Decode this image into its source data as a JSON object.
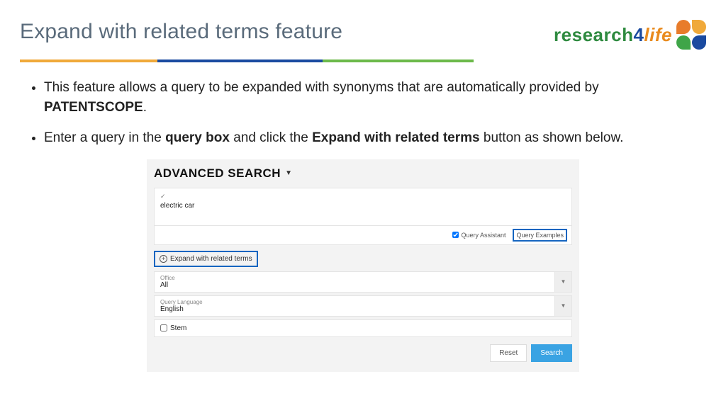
{
  "header": {
    "title": "Expand with related terms feature",
    "logo": {
      "word1": "research",
      "word2": "4",
      "word3": "life"
    }
  },
  "bullets": {
    "b1_pre": "This feature allows a query to be expanded with synonyms that are automatically provided by ",
    "b1_bold": "PATENTSCOPE",
    "b1_post": ".",
    "b2_pre": "Enter a query in the ",
    "b2_bold1": "query box",
    "b2_mid": " and click the ",
    "b2_bold2": "Expand with related terms",
    "b2_post": " button as shown below."
  },
  "shot": {
    "heading": "ADVANCED SEARCH",
    "query_value": "electric car",
    "query_assistant_label": "Query Assistant",
    "query_examples_label": "Query Examples",
    "expand_label": "Expand with related terms",
    "office": {
      "label": "Office",
      "value": "All"
    },
    "language": {
      "label": "Query Language",
      "value": "English"
    },
    "stem_label": "Stem",
    "reset_label": "Reset",
    "search_label": "Search"
  }
}
